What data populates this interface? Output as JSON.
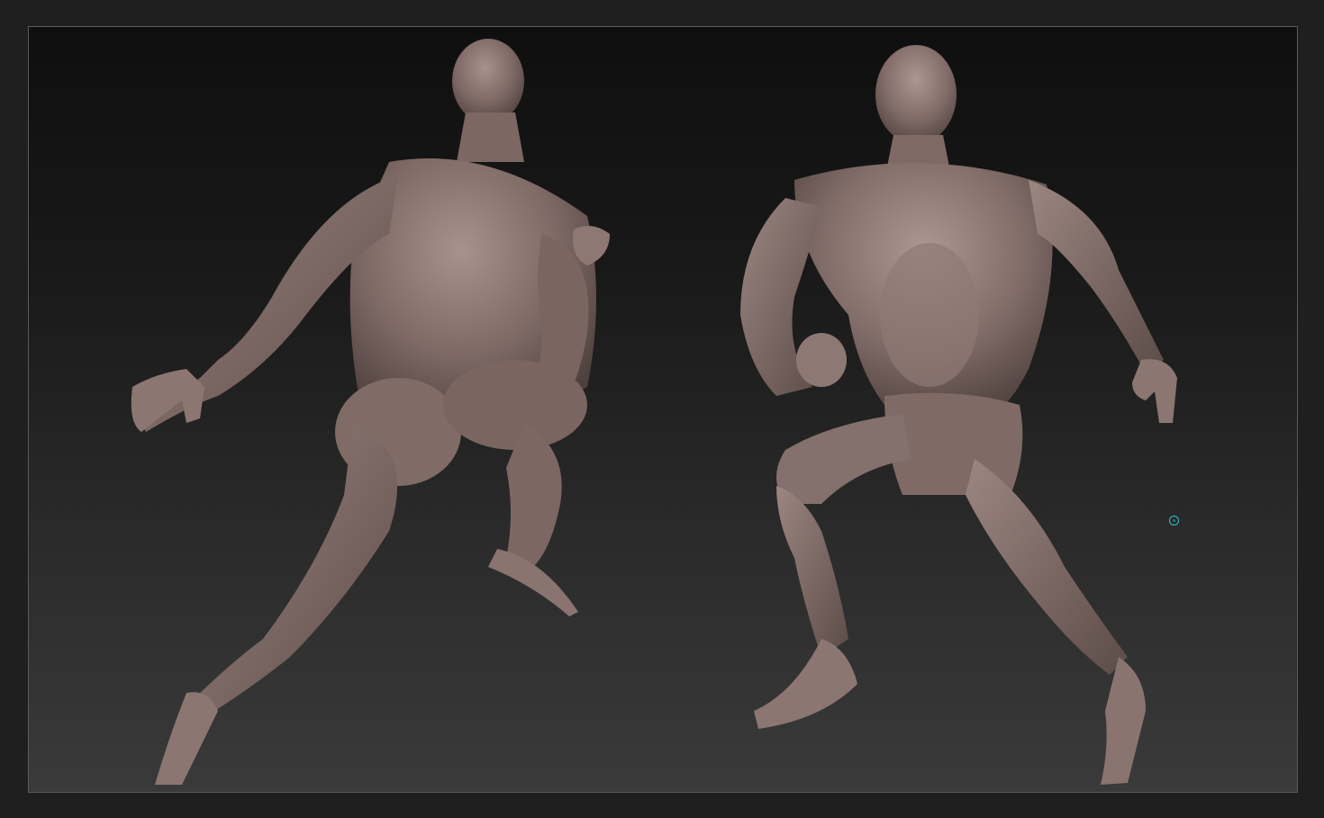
{
  "viewport": {
    "background_top": "#0f0f0f",
    "background_bottom": "#3a3a3a",
    "frame_border": "#5a5a5a"
  },
  "model": {
    "material_color": "#8a7470",
    "views": [
      "back-view",
      "front-view"
    ]
  },
  "cursor": {
    "icon": "brush-cursor-icon",
    "color": "#2fc4c0"
  }
}
